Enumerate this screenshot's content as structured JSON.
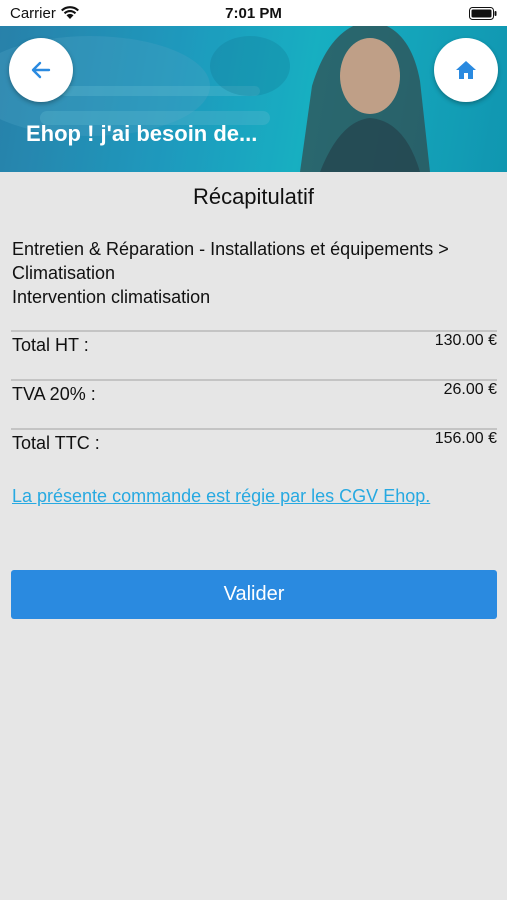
{
  "status_bar": {
    "carrier": "Carrier",
    "time": "7:01 PM"
  },
  "header": {
    "title": "Ehop ! j'ai besoin de..."
  },
  "summary": {
    "title": "Récapitulatif",
    "service_path": "Entretien & Réparation - Installations et équipements > Climatisation",
    "service_name": "Intervention climatisation",
    "totals": [
      {
        "label": "Total HT :",
        "value": "130.00 €"
      },
      {
        "label": "TVA 20% :",
        "value": "26.00 €"
      },
      {
        "label": "Total TTC :",
        "value": "156.00 €"
      }
    ],
    "cgv_link": "La présente commande est régie par les CGV Ehop.",
    "validate_label": "Valider"
  },
  "colors": {
    "accent": "#2a8ae0",
    "link": "#27a9e1",
    "background": "#e6e6e6"
  }
}
